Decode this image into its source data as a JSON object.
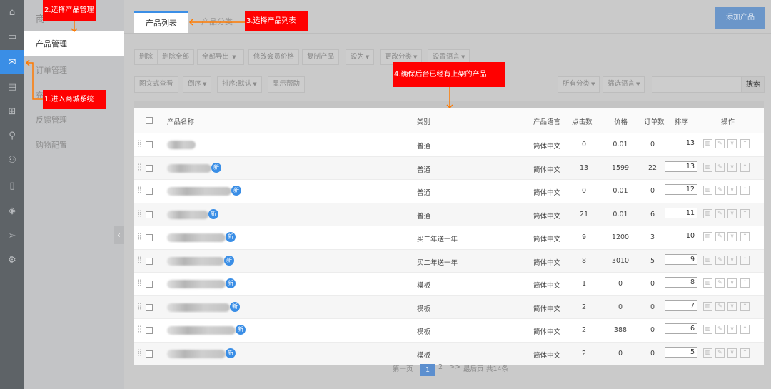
{
  "iconbar": {
    "icons": [
      "home-icon",
      "monitor-icon",
      "shop-icon",
      "calendar-icon",
      "gift-icon",
      "org-chart-icon",
      "users-icon",
      "document-icon",
      "cube-icon",
      "send-icon",
      "gear-icon"
    ],
    "active": 2
  },
  "subnav": {
    "title": "商",
    "items": [
      "产品管理",
      "订单管理",
      "充",
      "反馈管理",
      "购物配置"
    ]
  },
  "tabs": [
    "产品列表",
    "产品分类"
  ],
  "add_button": "添加产品",
  "toolbar1": [
    "删除",
    "删除全部",
    "全部导出",
    "修改会员价格",
    "复制产品",
    "设为",
    "更改分类",
    "设置语言"
  ],
  "toolbar2": [
    "图文式查看",
    "倒序",
    "排序:默认",
    "显示帮助"
  ],
  "filters": {
    "category": "所有分类",
    "language": "筛选语言",
    "search_value": "",
    "search_button": "搜索"
  },
  "table": {
    "headers": [
      "产品名称",
      "类别",
      "产品语言",
      "点击数",
      "价格",
      "订单数",
      "排序",
      "操作"
    ],
    "new_badge": "新",
    "rows": [
      {
        "category": "普通",
        "lang": "简体中文",
        "clicks": "0",
        "price": "0.01",
        "orders": "0",
        "sort": "13",
        "is_new": false
      },
      {
        "category": "普通",
        "lang": "简体中文",
        "clicks": "13",
        "price": "1599",
        "orders": "22",
        "sort": "13",
        "is_new": true
      },
      {
        "category": "普通",
        "lang": "简体中文",
        "clicks": "0",
        "price": "0.01",
        "orders": "0",
        "sort": "12",
        "is_new": true
      },
      {
        "category": "普通",
        "lang": "简体中文",
        "clicks": "21",
        "price": "0.01",
        "orders": "6",
        "sort": "11",
        "is_new": true
      },
      {
        "category": "买二年送一年",
        "lang": "简体中文",
        "clicks": "9",
        "price": "1200",
        "orders": "3",
        "sort": "10",
        "is_new": true
      },
      {
        "category": "买二年送一年",
        "lang": "简体中文",
        "clicks": "8",
        "price": "3010",
        "orders": "5",
        "sort": "9",
        "is_new": true
      },
      {
        "category": "模板",
        "lang": "简体中文",
        "clicks": "1",
        "price": "0",
        "orders": "0",
        "sort": "8",
        "is_new": true
      },
      {
        "category": "模板",
        "lang": "简体中文",
        "clicks": "2",
        "price": "0",
        "orders": "0",
        "sort": "7",
        "is_new": true
      },
      {
        "category": "模板",
        "lang": "简体中文",
        "clicks": "2",
        "price": "388",
        "orders": "0",
        "sort": "6",
        "is_new": true
      },
      {
        "category": "模板",
        "lang": "简体中文",
        "clicks": "2",
        "price": "0",
        "orders": "0",
        "sort": "5",
        "is_new": true
      }
    ]
  },
  "pagination": {
    "first": "第一页",
    "current": "1",
    "next_page": "2",
    "next": ">>",
    "last": "最后页",
    "total": "共14条"
  },
  "annotations": [
    "1.进入商城系统",
    "2.选择产品管理",
    "3.选择产品列表",
    "4.确保后台已经有上架的产品"
  ],
  "colors": {
    "accent": "#3a8ee6",
    "annotation": "#ff0000",
    "arrow": "#ff7a00"
  }
}
